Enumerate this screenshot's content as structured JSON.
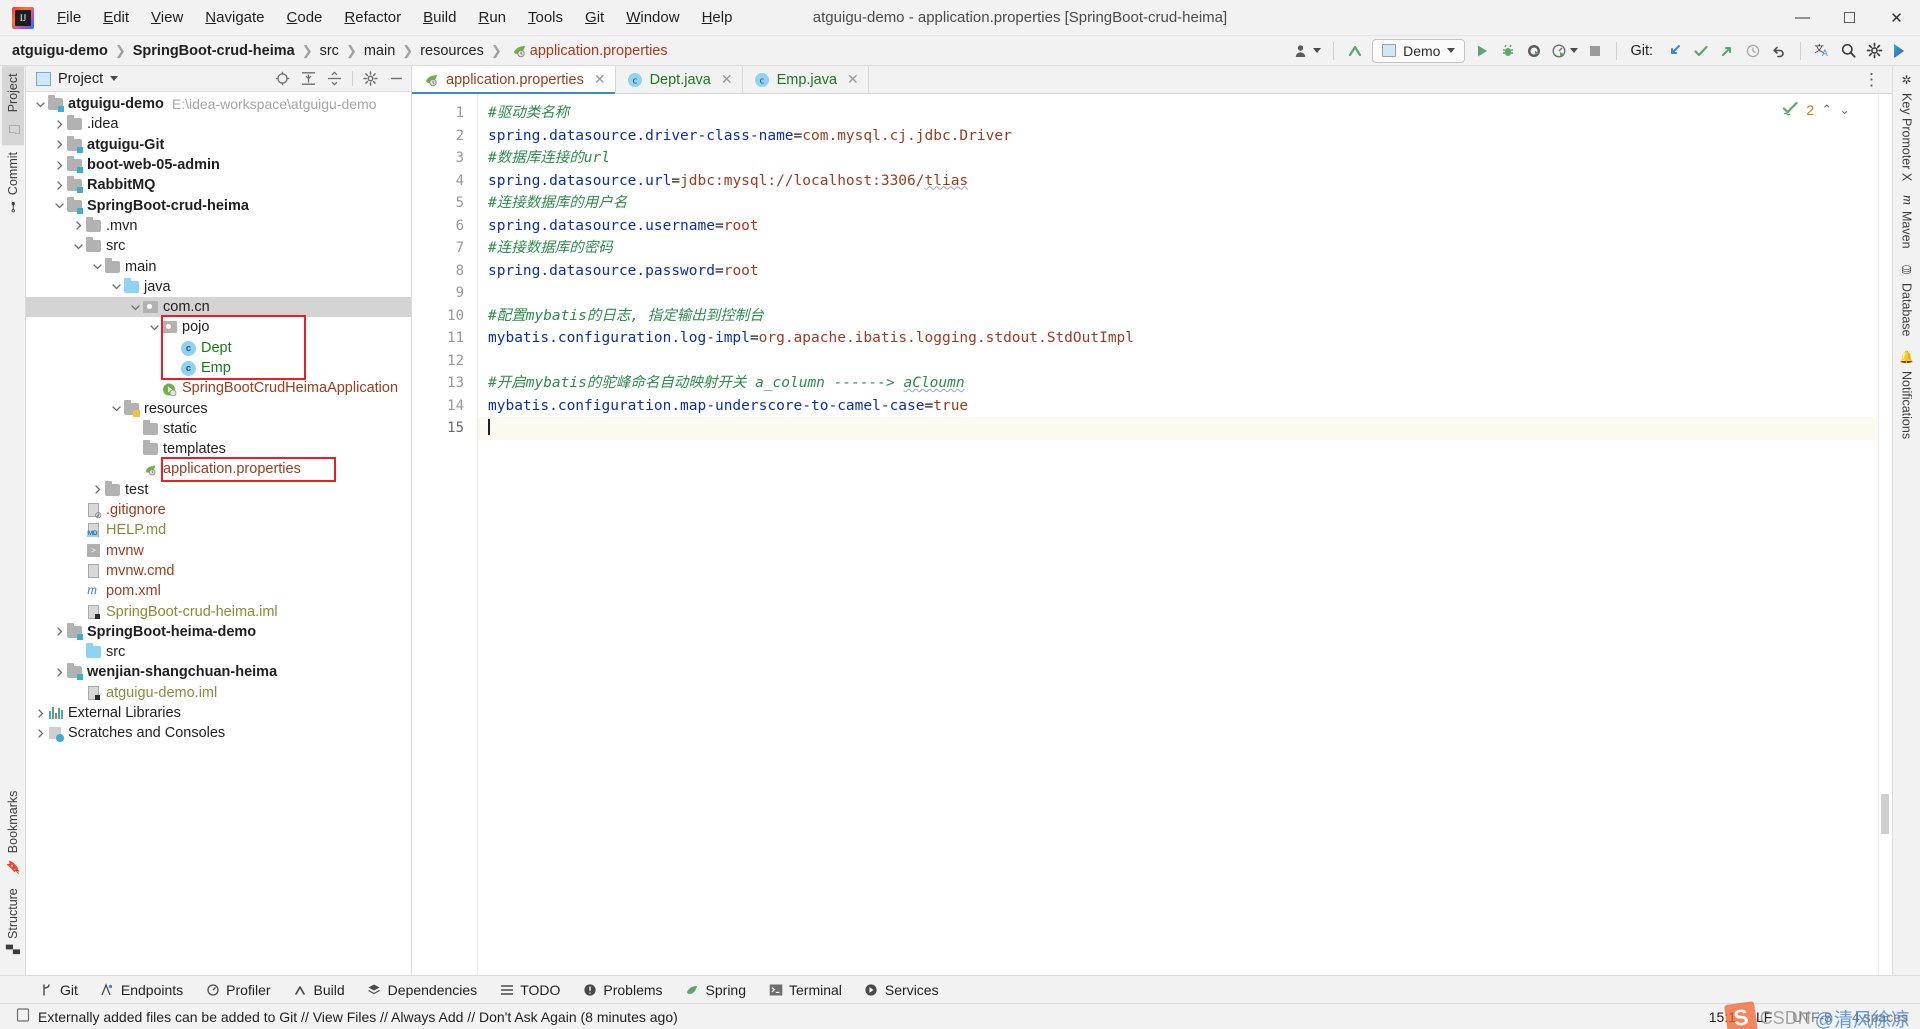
{
  "window": {
    "title": "atguigu-demo - application.properties [SpringBoot-crud-heima]",
    "minimize": "—",
    "maximize": "▢",
    "close": "✕"
  },
  "menu": {
    "items": [
      {
        "label": "File"
      },
      {
        "label": "Edit"
      },
      {
        "label": "View"
      },
      {
        "label": "Navigate"
      },
      {
        "label": "Code"
      },
      {
        "label": "Refactor"
      },
      {
        "label": "Build"
      },
      {
        "label": "Run"
      },
      {
        "label": "Tools"
      },
      {
        "label": "Git"
      },
      {
        "label": "Window"
      },
      {
        "label": "Help"
      }
    ]
  },
  "navbar": {
    "breadcrumbs": [
      {
        "label": "atguigu-demo",
        "style": "bold"
      },
      {
        "label": "SpringBoot-crud-heima",
        "style": "bold"
      },
      {
        "label": "src",
        "style": "normal"
      },
      {
        "label": "main",
        "style": "normal"
      },
      {
        "label": "resources",
        "style": "normal"
      },
      {
        "label": "application.properties",
        "style": "file"
      }
    ],
    "separator": "❯",
    "run_config": "Demo",
    "git_label": "Git:",
    "icons": {
      "user": "user-icon",
      "update": "update-project-icon",
      "run": "run-icon",
      "debug": "debug-icon",
      "coverage": "run-with-coverage-icon",
      "profiler": "profiler-icon",
      "stop": "stop-icon",
      "git_pull": "git-update-icon",
      "git_commit": "git-commit-icon",
      "git_push": "git-push-icon",
      "git_history": "git-history-icon",
      "git_rollback": "git-rollback-icon",
      "translate": "translate-icon",
      "search": "search-everywhere-icon",
      "settings": "settings-icon",
      "ide_assist": "ide-assistant-icon"
    }
  },
  "left_strip": {
    "tabs": [
      {
        "label": "Project",
        "icon": "project-icon",
        "active": true
      },
      {
        "label": "Commit",
        "icon": "commit-icon",
        "active": false
      }
    ],
    "bottom_tabs": [
      {
        "label": "Bookmarks",
        "icon": "bookmark-icon"
      },
      {
        "label": "Structure",
        "icon": "structure-icon"
      }
    ]
  },
  "right_strip": {
    "tabs": [
      {
        "label": "Key Promoter X",
        "icon": "key-promoter-icon"
      },
      {
        "label": "Maven",
        "icon": "maven-icon"
      },
      {
        "label": "Database",
        "icon": "database-icon"
      },
      {
        "label": "Notifications",
        "icon": "notifications-icon"
      }
    ]
  },
  "project_panel": {
    "title": "Project",
    "toolbar_icons": [
      "select-opened-file-icon",
      "expand-all-icon",
      "collapse-all-icon",
      "settings-icon",
      "hide-icon"
    ],
    "tree": [
      {
        "depth": 0,
        "arrow": "down",
        "icon": "module-folder",
        "label": "atguigu-demo",
        "style": "bold",
        "hint": "E:\\idea-workspace\\atguigu-demo"
      },
      {
        "depth": 1,
        "arrow": "right",
        "icon": "folder",
        "label": ".idea",
        "style": "normal"
      },
      {
        "depth": 1,
        "arrow": "right",
        "icon": "module-folder",
        "label": "atguigu-Git",
        "style": "bold"
      },
      {
        "depth": 1,
        "arrow": "right",
        "icon": "module-folder",
        "label": "boot-web-05-admin",
        "style": "bold"
      },
      {
        "depth": 1,
        "arrow": "right",
        "icon": "module-folder",
        "label": "RabbitMQ",
        "style": "bold"
      },
      {
        "depth": 1,
        "arrow": "down",
        "icon": "module-folder",
        "label": "SpringBoot-crud-heima",
        "style": "bold"
      },
      {
        "depth": 2,
        "arrow": "right",
        "icon": "folder",
        "label": ".mvn",
        "style": "normal"
      },
      {
        "depth": 2,
        "arrow": "down",
        "icon": "folder",
        "label": "src",
        "style": "normal"
      },
      {
        "depth": 3,
        "arrow": "down",
        "icon": "folder",
        "label": "main",
        "style": "normal"
      },
      {
        "depth": 4,
        "arrow": "down",
        "icon": "source-folder",
        "label": "java",
        "style": "normal"
      },
      {
        "depth": 5,
        "arrow": "down",
        "icon": "package",
        "label": "com.cn",
        "style": "normal",
        "selected": true
      },
      {
        "depth": 6,
        "arrow": "down",
        "icon": "package",
        "label": "pojo",
        "style": "normal"
      },
      {
        "depth": 7,
        "arrow": "none",
        "icon": "class",
        "label": "Dept",
        "style": "green"
      },
      {
        "depth": 7,
        "arrow": "none",
        "icon": "class",
        "label": "Emp",
        "style": "green"
      },
      {
        "depth": 6,
        "arrow": "none",
        "icon": "spring-boot-app",
        "label": "SpringBootCrudHeimaApplication",
        "style": "brown"
      },
      {
        "depth": 4,
        "arrow": "down",
        "icon": "resource-folder",
        "label": "resources",
        "style": "normal"
      },
      {
        "depth": 5,
        "arrow": "none",
        "icon": "folder",
        "label": "static",
        "style": "normal"
      },
      {
        "depth": 5,
        "arrow": "none",
        "icon": "folder",
        "label": "templates",
        "style": "normal"
      },
      {
        "depth": 5,
        "arrow": "none",
        "icon": "spring-properties",
        "label": "application.properties",
        "style": "brown"
      },
      {
        "depth": 3,
        "arrow": "right",
        "icon": "folder",
        "label": "test",
        "style": "normal"
      },
      {
        "depth": 2,
        "arrow": "none",
        "icon": "gitignore-file",
        "label": ".gitignore",
        "style": "brown"
      },
      {
        "depth": 2,
        "arrow": "none",
        "icon": "markdown-file",
        "label": "HELP.md",
        "style": "olive"
      },
      {
        "depth": 2,
        "arrow": "none",
        "icon": "script-file",
        "label": "mvnw",
        "style": "brown"
      },
      {
        "depth": 2,
        "arrow": "none",
        "icon": "cmd-file",
        "label": "mvnw.cmd",
        "style": "brown"
      },
      {
        "depth": 2,
        "arrow": "none",
        "icon": "maven-pom",
        "label": "pom.xml",
        "style": "brown"
      },
      {
        "depth": 2,
        "arrow": "none",
        "icon": "iml-file",
        "label": "SpringBoot-crud-heima.iml",
        "style": "olive"
      },
      {
        "depth": 1,
        "arrow": "right",
        "icon": "module-folder",
        "label": "SpringBoot-heima-demo",
        "style": "bold"
      },
      {
        "depth": 2,
        "arrow": "none",
        "icon": "source-folder",
        "label": "src",
        "style": "normal"
      },
      {
        "depth": 1,
        "arrow": "right",
        "icon": "module-folder",
        "label": "wenjian-shangchuan-heima",
        "style": "bold"
      },
      {
        "depth": 2,
        "arrow": "none",
        "icon": "iml-file",
        "label": "atguigu-demo.iml",
        "style": "olive"
      },
      {
        "depth": 0,
        "arrow": "right",
        "icon": "external-libraries",
        "label": "External Libraries",
        "style": "normal"
      },
      {
        "depth": 0,
        "arrow": "right",
        "icon": "scratches",
        "label": "Scratches and Consoles",
        "style": "normal"
      }
    ]
  },
  "editor": {
    "tabs": [
      {
        "label": "application.properties",
        "icon": "spring-properties-icon",
        "active": true,
        "close": "✕"
      },
      {
        "label": "Dept.java",
        "icon": "class-icon",
        "active": false,
        "close": "✕"
      },
      {
        "label": "Emp.java",
        "icon": "class-icon",
        "active": false,
        "close": "✕"
      }
    ],
    "inspection": {
      "count": "2",
      "up": "⌃",
      "down": "⌄"
    },
    "lines": [
      {
        "n": "1",
        "segments": [
          {
            "t": "#驱动类名称",
            "c": "cmt"
          }
        ]
      },
      {
        "n": "2",
        "segments": [
          {
            "t": "spring.datasource.driver-class-name",
            "c": "key"
          },
          {
            "t": "=",
            "c": "eq"
          },
          {
            "t": "com.mysql.cj.jdbc.Driver",
            "c": "val"
          }
        ]
      },
      {
        "n": "3",
        "segments": [
          {
            "t": "#数据库连接的url",
            "c": "cmt"
          }
        ]
      },
      {
        "n": "4",
        "segments": [
          {
            "t": "spring.datasource.url",
            "c": "key"
          },
          {
            "t": "=",
            "c": "eq"
          },
          {
            "t": "jdbc:mysql://localhost:3306/",
            "c": "val"
          },
          {
            "t": "tlias",
            "c": "val wavy"
          }
        ]
      },
      {
        "n": "5",
        "segments": [
          {
            "t": "#连接数据库的用户名",
            "c": "cmt"
          }
        ]
      },
      {
        "n": "6",
        "segments": [
          {
            "t": "spring.datasource.username",
            "c": "key"
          },
          {
            "t": "=",
            "c": "eq"
          },
          {
            "t": "root",
            "c": "val"
          }
        ]
      },
      {
        "n": "7",
        "segments": [
          {
            "t": "#连接数据库的密码",
            "c": "cmt"
          }
        ]
      },
      {
        "n": "8",
        "segments": [
          {
            "t": "spring.datasource.password",
            "c": "key"
          },
          {
            "t": "=",
            "c": "eq"
          },
          {
            "t": "root",
            "c": "val"
          }
        ]
      },
      {
        "n": "9",
        "segments": []
      },
      {
        "n": "10",
        "segments": [
          {
            "t": "#配置mybatis的日志, 指定输出到控制台",
            "c": "cmt"
          }
        ]
      },
      {
        "n": "11",
        "segments": [
          {
            "t": "mybatis.configuration.log-impl",
            "c": "key"
          },
          {
            "t": "=",
            "c": "eq"
          },
          {
            "t": "org.apache.ibatis.logging.stdout.StdOutImpl",
            "c": "val"
          }
        ]
      },
      {
        "n": "12",
        "segments": []
      },
      {
        "n": "13",
        "segments": [
          {
            "t": "#开启mybatis的驼峰命名自动映射开关 a_column ------> ",
            "c": "cmt"
          },
          {
            "t": "aCloumn",
            "c": "cmt wavy"
          }
        ]
      },
      {
        "n": "14",
        "segments": [
          {
            "t": "mybatis.configuration.map-underscore-to-camel-case",
            "c": "key"
          },
          {
            "t": "=",
            "c": "eq"
          },
          {
            "t": "true",
            "c": "val"
          }
        ]
      },
      {
        "n": "15",
        "segments": [],
        "current": true,
        "caret": true
      }
    ]
  },
  "bottom_bar": {
    "items": [
      {
        "label": "Git",
        "icon": "git-branch-icon"
      },
      {
        "label": "Endpoints",
        "icon": "endpoints-icon"
      },
      {
        "label": "Profiler",
        "icon": "profiler-icon"
      },
      {
        "label": "Build",
        "icon": "build-icon"
      },
      {
        "label": "Dependencies",
        "icon": "dependencies-icon"
      },
      {
        "label": "TODO",
        "icon": "todo-icon"
      },
      {
        "label": "Problems",
        "icon": "problems-icon"
      },
      {
        "label": "Spring",
        "icon": "spring-icon"
      },
      {
        "label": "Terminal",
        "icon": "terminal-icon"
      },
      {
        "label": "Services",
        "icon": "services-icon"
      }
    ]
  },
  "status_bar": {
    "message": "Externally added files can be added to Git // View Files // Always Add // Don't Ask Again (8 minutes ago)",
    "message_icon": "event-log-icon",
    "caret_position": "15:1",
    "line_separator": "LF",
    "encoding": "UTF-8",
    "indent": "4 spaces",
    "watermark": {
      "badge": "S",
      "brand": "CSDN",
      "handle": "@清风徐凉"
    }
  },
  "colors": {
    "accent": "#3c8cc4",
    "comment_green": "#2d8c4e",
    "key_blue": "#0a2fa8",
    "value_brown": "#9b3c1f",
    "highlight_red": "#ee1c25",
    "selection_grey": "#d4d4d4"
  }
}
